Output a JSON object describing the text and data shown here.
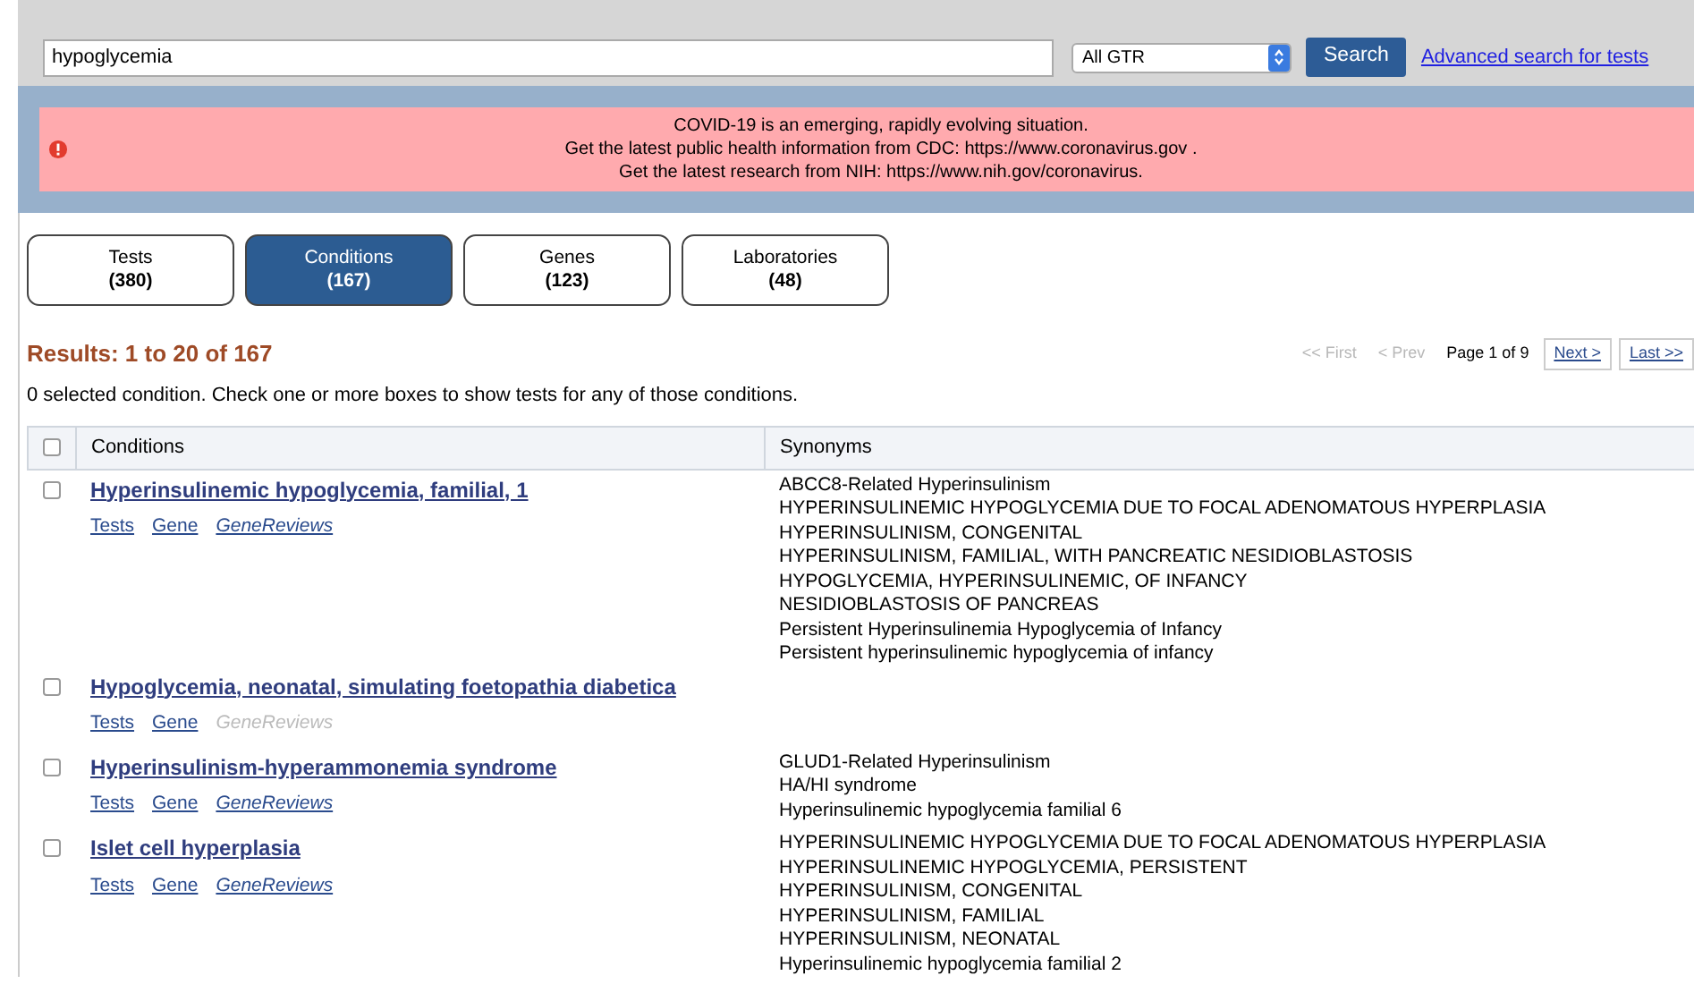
{
  "search": {
    "value": "hypoglycemia",
    "scope": "All GTR",
    "button": "Search",
    "advanced_link": "Advanced search for tests"
  },
  "alert": {
    "lines": [
      {
        "text": "COVID-19 is an emerging, rapidly evolving situation."
      },
      {
        "text": "Get the latest public health information from CDC:",
        "link": "https://www.coronavirus.gov",
        "after": " ."
      },
      {
        "text": "Get the latest research from NIH:",
        "link": "https://www.nih.gov/coronavirus",
        "after": "."
      }
    ]
  },
  "tabs": [
    {
      "label": "Tests",
      "count": "(380)",
      "selected": false
    },
    {
      "label": "Conditions",
      "count": "(167)",
      "selected": true
    },
    {
      "label": "Genes",
      "count": "(123)",
      "selected": false
    },
    {
      "label": "Laboratories",
      "count": "(48)",
      "selected": false
    }
  ],
  "results_heading": "Results: 1 to 20 of 167",
  "pager": {
    "first": "<< First",
    "prev": "< Prev",
    "page": "Page 1 of 9",
    "next": "Next >",
    "last": "Last >>"
  },
  "selection_note": "0 selected condition. Check one or more boxes to show tests for any of those conditions.",
  "table": {
    "select_all_checked": false,
    "columns": [
      "Conditions",
      "Synonyms"
    ],
    "rows": [
      {
        "checked": false,
        "title": "Hyperinsulinemic hypoglycemia, familial, 1",
        "links": [
          {
            "label": "Tests",
            "italic": false,
            "disabled": false
          },
          {
            "label": "Gene",
            "italic": false,
            "disabled": false
          },
          {
            "label": "GeneReviews",
            "italic": true,
            "disabled": false
          }
        ],
        "synonyms": [
          "ABCC8-Related Hyperinsulinism",
          "HYPERINSULINEMIC HYPOGLYCEMIA DUE TO FOCAL ADENOMATOUS HYPERPLASIA",
          "HYPERINSULINISM, CONGENITAL",
          "HYPERINSULINISM, FAMILIAL, WITH PANCREATIC NESIDIOBLASTOSIS",
          "HYPOGLYCEMIA, HYPERINSULINEMIC, OF INFANCY",
          "NESIDIOBLASTOSIS OF PANCREAS",
          "Persistent Hyperinsulinemia Hypoglycemia of Infancy",
          "Persistent hyperinsulinemic hypoglycemia of infancy"
        ]
      },
      {
        "checked": false,
        "title": "Hypoglycemia, neonatal, simulating foetopathia diabetica",
        "links": [
          {
            "label": "Tests",
            "italic": false,
            "disabled": false
          },
          {
            "label": "Gene",
            "italic": false,
            "disabled": false
          },
          {
            "label": "GeneReviews",
            "italic": true,
            "disabled": true
          }
        ]
      },
      {
        "checked": false,
        "title": "Hyperinsulinism-hyperammonemia syndrome",
        "links": [
          {
            "label": "Tests",
            "italic": false,
            "disabled": false
          },
          {
            "label": "Gene",
            "italic": false,
            "disabled": false
          },
          {
            "label": "GeneReviews",
            "italic": true,
            "disabled": false
          }
        ],
        "synonyms": [
          "GLUD1-Related Hyperinsulinism",
          "HA/HI syndrome",
          "Hyperinsulinemic hypoglycemia familial 6"
        ]
      },
      {
        "checked": false,
        "title": "Islet cell hyperplasia",
        "links": [
          {
            "label": "Tests",
            "italic": false,
            "disabled": false
          },
          {
            "label": "Gene",
            "italic": false,
            "disabled": false
          },
          {
            "label": "GeneReviews",
            "italic": true,
            "disabled": false
          }
        ],
        "synonyms": [
          "HYPERINSULINEMIC HYPOGLYCEMIA DUE TO FOCAL ADENOMATOUS HYPERPLASIA",
          "HYPERINSULINEMIC HYPOGLYCEMIA, PERSISTENT",
          "HYPERINSULINISM, CONGENITAL",
          "HYPERINSULINISM, FAMILIAL",
          "HYPERINSULINISM, NEONATAL",
          "Hyperinsulinemic hypoglycemia familial 2"
        ]
      }
    ]
  }
}
